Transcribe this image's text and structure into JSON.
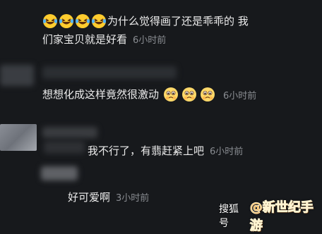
{
  "comments": [
    {
      "lead_emojis": [
        "laughing-tears",
        "laughing-tears",
        "laughing-tears",
        "laughing-tears"
      ],
      "text_line1": "为什么觉得画了还是乖乖的 我",
      "text_line2": "们家宝贝就是好看",
      "time": "6小时前"
    },
    {
      "text": "想想化成这样竟然很激动",
      "trail_emojis": [
        "moved-face",
        "moved-face",
        "moved-face"
      ],
      "time": "6小时前"
    },
    {
      "text": "我不行了，有翡赶紧上吧",
      "time": "6小时前"
    },
    {
      "text": "好可爱啊",
      "time": "3小时前"
    }
  ],
  "watermark": {
    "source": "搜狐号",
    "site": "@新世纪手游"
  },
  "colors": {
    "background": "#17191c",
    "text": "#ececec",
    "time": "#8a8d92",
    "watermark_orange": "#f39a1c"
  }
}
